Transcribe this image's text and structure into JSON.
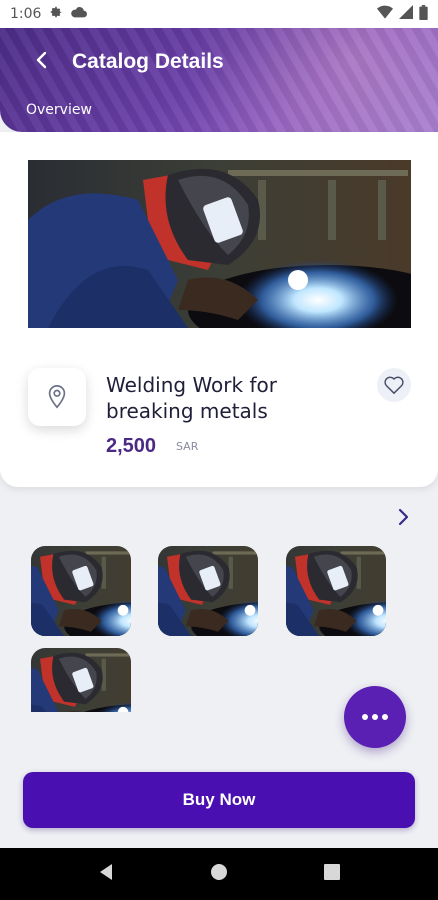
{
  "status_bar": {
    "time": "1:06",
    "icons": [
      "settings-icon",
      "cloud-icon",
      "wifi-icon",
      "signal-icon",
      "battery-icon"
    ]
  },
  "header": {
    "title": "Catalog Details",
    "tab": "Overview",
    "back_icon": "back-arrow-icon"
  },
  "product": {
    "title": "Welding Work for breaking metals",
    "price": "2,500",
    "currency": "SAR",
    "location_icon": "location-pin-icon",
    "favorite_icon": "heart-icon"
  },
  "gallery": {
    "chevron_icon": "chevron-right-icon",
    "thumbnail_count": 4
  },
  "fab": {
    "icon": "more-dots-icon"
  },
  "buy_button": {
    "label": "Buy Now"
  },
  "nav_bar": {
    "icons": [
      "back-triangle-icon",
      "home-circle-icon",
      "recents-square-icon"
    ]
  },
  "colors": {
    "primary": "#4a0fb0",
    "price": "#4b2a86",
    "header_gradient_start": "#4b2c86",
    "header_gradient_end": "#a27ad0"
  }
}
